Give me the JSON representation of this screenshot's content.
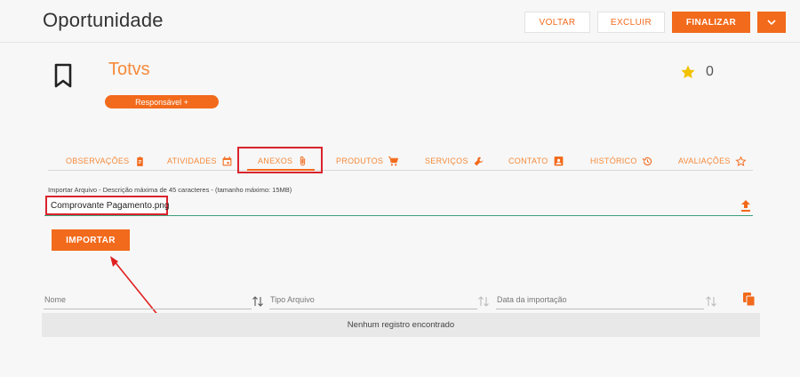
{
  "header": {
    "title": "Oportunidade",
    "buttons": {
      "voltar": "VOLTAR",
      "excluir": "EXCLUIR",
      "finalizar": "FINALIZAR"
    }
  },
  "opportunity": {
    "name": "Totvs",
    "responsible_label": "Responsável +",
    "rating": "0"
  },
  "tabs": [
    {
      "label": "OBSERVAÇÕES",
      "icon": "clipboard-icon"
    },
    {
      "label": "ATIVIDADES",
      "icon": "calendar-icon"
    },
    {
      "label": "ANEXOS",
      "icon": "paperclip-icon",
      "active": true
    },
    {
      "label": "PRODUTOS",
      "icon": "cart-icon"
    },
    {
      "label": "SERVIÇOS",
      "icon": "wrench-icon"
    },
    {
      "label": "CONTATO",
      "icon": "contact-card-icon"
    },
    {
      "label": "HISTÓRICO",
      "icon": "history-icon"
    },
    {
      "label": "AVALIAÇÕES",
      "icon": "star-outline-icon"
    }
  ],
  "import": {
    "label": "Importar Arquivo - Descrição máxima de 45 caracteres - (tamanho máximo: 15MB)",
    "file_name": "Comprovante Pagamento.png",
    "button": "IMPORTAR"
  },
  "table": {
    "columns": [
      "Nome",
      "Tipo Arquivo",
      "Data da importação"
    ],
    "empty_message": "Nenhum registro encontrado"
  },
  "colors": {
    "accent": "#f26a1b",
    "highlight": "#d9232d",
    "field_underline": "#3aa17a",
    "star": "#f2c200"
  }
}
